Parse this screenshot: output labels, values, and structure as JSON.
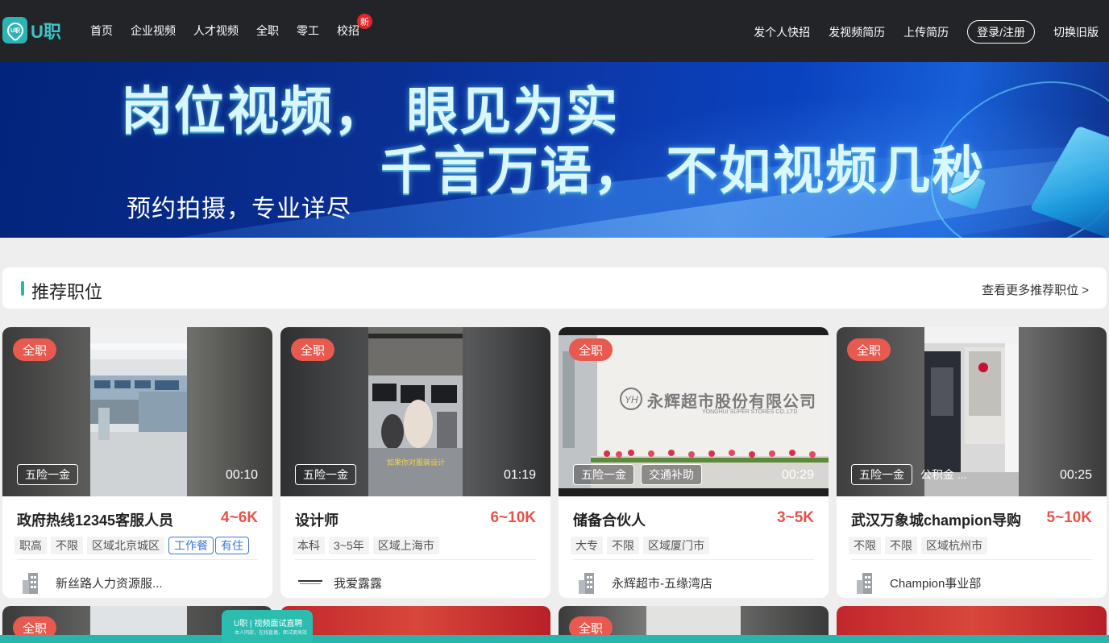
{
  "header": {
    "logo_text": "U职",
    "nav": [
      {
        "label": "首页"
      },
      {
        "label": "企业视频"
      },
      {
        "label": "人才视频"
      },
      {
        "label": "全职"
      },
      {
        "label": "零工"
      },
      {
        "label": "校招",
        "badge": "新"
      }
    ],
    "right_nav": [
      {
        "label": "发个人快招"
      },
      {
        "label": "发视频简历"
      },
      {
        "label": "上传简历"
      },
      {
        "label": "登录/注册"
      },
      {
        "label": "切换旧版"
      }
    ]
  },
  "banner": {
    "line1": "岗位视频， 眼见为实",
    "line2": "千言万语， 不如视频几秒",
    "line3": "预约拍摄，专业详尽"
  },
  "section": {
    "title": "推荐职位",
    "more_link": "查看更多推荐职位 >"
  },
  "jobs": [
    {
      "type": "全职",
      "benefits": [
        "五险一金"
      ],
      "duration": "00:10",
      "title": "政府热线12345客服人员",
      "salary": "4~6K",
      "reqs": [
        "职高",
        "不限",
        "区域北京城区"
      ],
      "reqs_highlight": [
        "工作餐",
        "有住"
      ],
      "company": "新丝路人力资源服..."
    },
    {
      "type": "全职",
      "benefits": [
        "五险一金"
      ],
      "duration": "01:19",
      "video_caption": "如果你对服装设计",
      "title": "设计师",
      "salary": "6~10K",
      "reqs": [
        "本科",
        "3~5年",
        "区域上海市"
      ],
      "reqs_highlight": [],
      "company": "我爱露露"
    },
    {
      "type": "全职",
      "benefits": [
        "五险一金",
        "交通补助"
      ],
      "duration": "00:29",
      "video_sign": "永辉超市股份有限公司",
      "video_sign_en": "YONGHUI SUPER STORES CO.,LTD",
      "title": "储备合伙人",
      "salary": "3~5K",
      "reqs": [
        "大专",
        "不限",
        "区域厦门市"
      ],
      "reqs_highlight": [],
      "company": "永辉超市-五缘湾店"
    },
    {
      "type": "全职",
      "benefits": [
        "五险一金",
        "公积金 ..."
      ],
      "duration": "00:25",
      "title": "武汉万象城champion导购",
      "salary": "5~10K",
      "reqs": [
        "不限",
        "不限",
        "区域杭州市"
      ],
      "reqs_highlight": [],
      "company": "Champion事业部"
    }
  ],
  "second_row_tags": [
    "全职",
    "全职"
  ],
  "promo": {
    "title": "U职 | 视频面试直聘",
    "sub": "本人同款，在线直播，面试更高效"
  },
  "colors": {
    "header_bg": "#232428",
    "brand": "#2bb3b6",
    "salary": "#e8534a",
    "type_tag": "#e85a4f",
    "page_bg": "#eeeeee"
  }
}
